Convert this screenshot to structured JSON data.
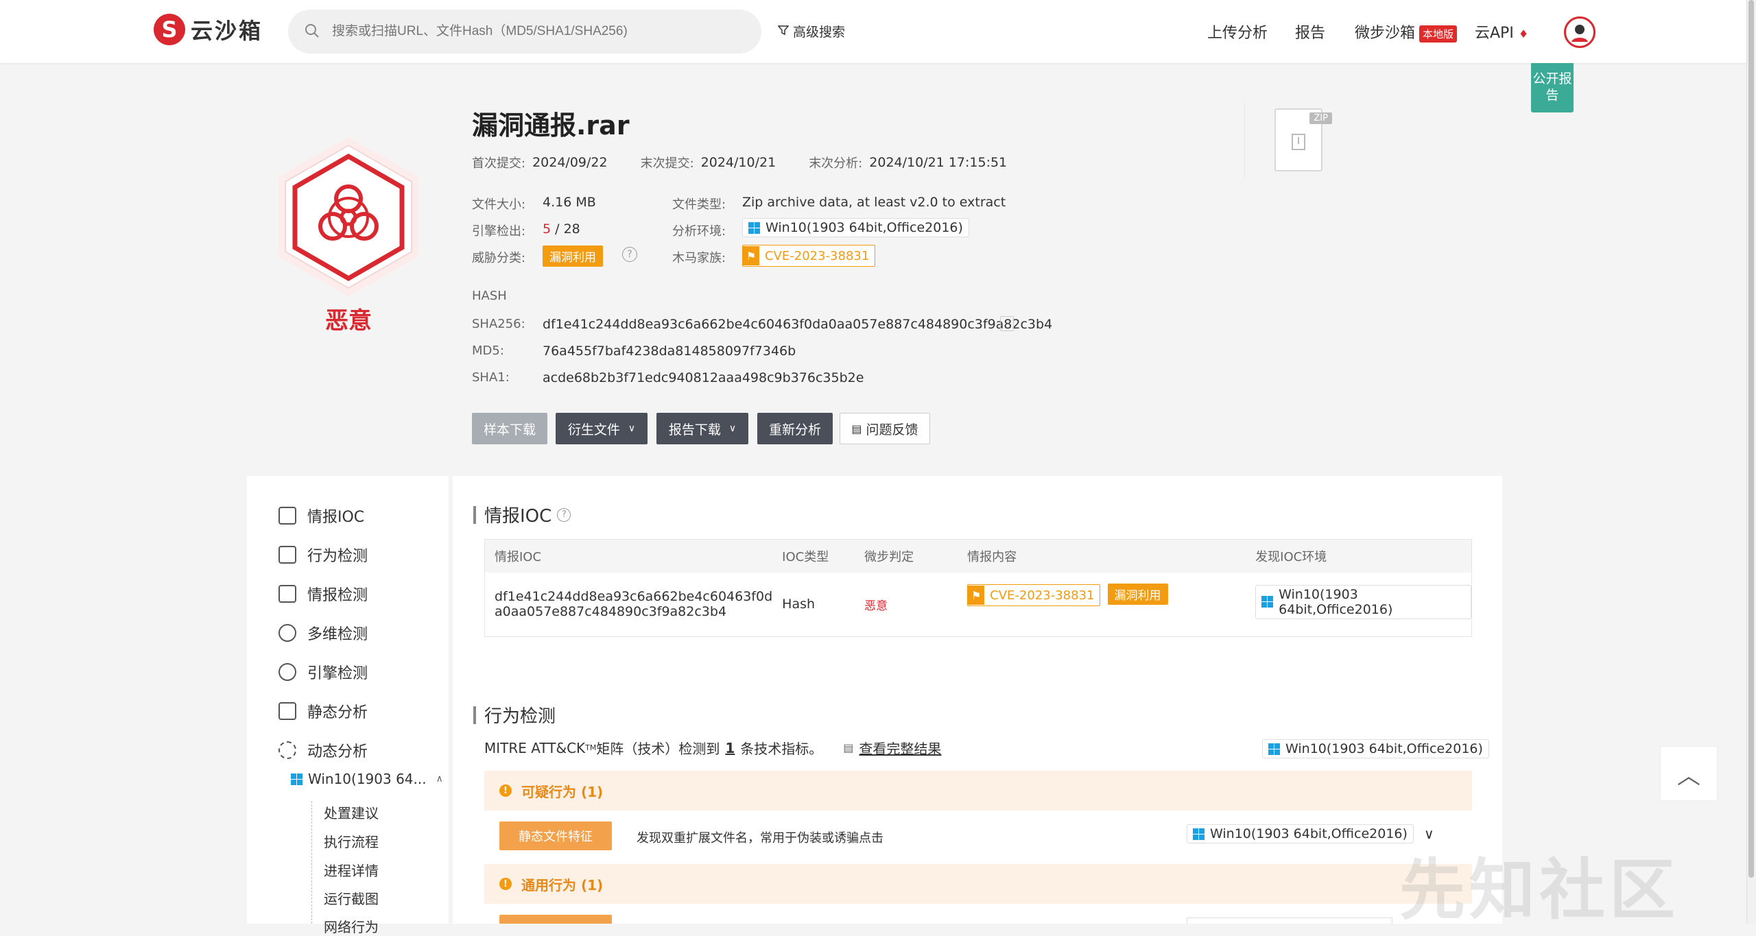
{
  "header": {
    "logo_text": "云沙箱",
    "search_placeholder": "搜索或扫描URL、文件Hash（MD5/SHA1/SHA256)",
    "advanced_search": "高级搜索",
    "nav": [
      "上传分析",
      "报告",
      "微步沙箱",
      "云API"
    ],
    "local_badge": "本地版",
    "public_report": "公开报告"
  },
  "file": {
    "name": "漏洞通报.rar",
    "verdict": "恶意",
    "first_submit_label": "首次提交:",
    "first_submit": "2024/09/22",
    "last_submit_label": "末次提交:",
    "last_submit": "2024/10/21",
    "last_analysis_label": "末次分析:",
    "last_analysis": "2024/10/21 17:15:51",
    "size_label": "文件大小:",
    "size": "4.16 MB",
    "type_label": "文件类型:",
    "type": "Zip archive data, at least v2.0 to extract",
    "engine_label": "引擎检出:",
    "engine_hit": "5",
    "engine_total": "/ 28",
    "env_label": "分析环境:",
    "env": "Win10(1903 64bit,Office2016)",
    "threat_label": "威胁分类:",
    "threat": "漏洞利用",
    "family_label": "木马家族:",
    "family": "CVE-2023-38831",
    "zip_label": "ZIP"
  },
  "hash": {
    "title": "HASH",
    "sha256_label": "SHA256:",
    "sha256": "df1e41c244dd8ea93c6a662be4c60463f0da0aa057e887c484890c3f9a82c3b4",
    "md5_label": "MD5:",
    "md5": "76a455f7baf4238da814858097f7346b",
    "sha1_label": "SHA1:",
    "sha1": "acde68b2b3f71edc940812aaa498c9b376c35b2e"
  },
  "actions": {
    "download_sample": "样本下载",
    "derived_files": "衍生文件",
    "download_report": "报告下载",
    "reanalyze": "重新分析",
    "feedback": "问题反馈"
  },
  "sidebar": {
    "items": [
      "情报IOC",
      "行为检测",
      "情报检测",
      "多维检测",
      "引擎检测",
      "静态分析",
      "动态分析"
    ],
    "env_item": "Win10(1903 64...",
    "sub_items": [
      "处置建议",
      "执行流程",
      "进程详情",
      "运行截图",
      "网络行为"
    ]
  },
  "ioc": {
    "title": "情报IOC",
    "columns": [
      "情报IOC",
      "IOC类型",
      "微步判定",
      "情报内容",
      "发现IOC环境"
    ],
    "row": {
      "ioc_line1": "df1e41c244dd8ea93c6a662be4c60463f0d",
      "ioc_line2": "a0aa057e887c484890c3f9a82c3b4",
      "type": "Hash",
      "verdict": "恶意",
      "cve": "CVE-2023-38831",
      "tag": "漏洞利用",
      "env": "Win10(1903 64bit,Office2016)"
    }
  },
  "behavior": {
    "title": "行为检测",
    "mitre_prefix": "MITRE ATT&CK",
    "mitre_tm": "TM",
    "mitre_mid": " 矩阵（技术）检测到",
    "mitre_count": "1",
    "mitre_suffix": "条技术指标。",
    "view_full": "查看完整结果",
    "env": "Win10(1903 64bit,Office2016)",
    "suspicious_head": "可疑行为 (1)",
    "static_tag": "静态文件特征",
    "static_desc": "发现双重扩展文件名，常用于伪装或诱骗点击",
    "general_head": "通用行为 (1)"
  },
  "watermark": "先知社区",
  "colors": {
    "brand_red": "#d9282f",
    "orange": "#f39c12",
    "teal": "#3bab98",
    "dark_button": "#4a4f5a"
  }
}
